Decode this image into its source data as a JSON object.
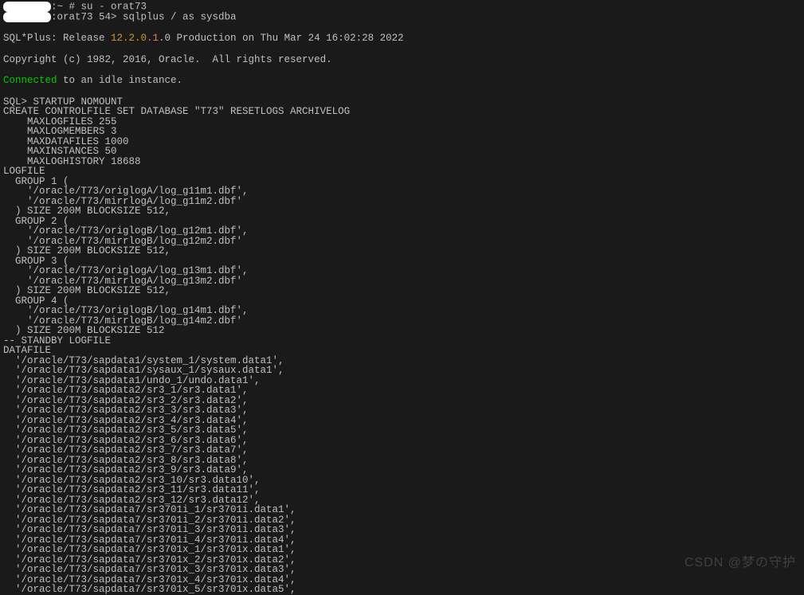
{
  "prompt1_prefix_masked": "        ",
  "prompt1_suffix": ":~ # su - orat73",
  "prompt2_prefix_masked": "        ",
  "prompt2_suffix": ":orat73 54> sqlplus / as sysdba",
  "release_prefix": "SQL*Plus: Release ",
  "release_version": "12.2.0.1",
  "release_suffix": ".0 Production on Thu Mar 24 16:02:28 2022",
  "copyright": "Copyright (c) 1982, 2016, Oracle.  All rights reserved.",
  "connected_word": "Connected",
  "connected_suffix": " to an idle instance.",
  "sql_lines": [
    "SQL> STARTUP NOMOUNT",
    "CREATE CONTROLFILE SET DATABASE \"T73\" RESETLOGS ARCHIVELOG",
    "    MAXLOGFILES 255",
    "    MAXLOGMEMBERS 3",
    "    MAXDATAFILES 1000",
    "    MAXINSTANCES 50",
    "    MAXLOGHISTORY 18688",
    "LOGFILE",
    "  GROUP 1 (",
    "    '/oracle/T73/origlogA/log_g11m1.dbf',",
    "    '/oracle/T73/mirrlogA/log_g11m2.dbf'",
    "  ) SIZE 200M BLOCKSIZE 512,",
    "  GROUP 2 (",
    "    '/oracle/T73/origlogB/log_g12m1.dbf',",
    "    '/oracle/T73/mirrlogB/log_g12m2.dbf'",
    "  ) SIZE 200M BLOCKSIZE 512,",
    "  GROUP 3 (",
    "    '/oracle/T73/origlogA/log_g13m1.dbf',",
    "    '/oracle/T73/mirrlogA/log_g13m2.dbf'",
    "  ) SIZE 200M BLOCKSIZE 512,",
    "  GROUP 4 (",
    "    '/oracle/T73/origlogB/log_g14m1.dbf',",
    "    '/oracle/T73/mirrlogB/log_g14m2.dbf'",
    "  ) SIZE 200M BLOCKSIZE 512",
    "-- STANDBY LOGFILE",
    "DATAFILE",
    "  '/oracle/T73/sapdata1/system_1/system.data1',",
    "  '/oracle/T73/sapdata1/sysaux_1/sysaux.data1',",
    "  '/oracle/T73/sapdata1/undo_1/undo.data1',",
    "  '/oracle/T73/sapdata2/sr3_1/sr3.data1',",
    "  '/oracle/T73/sapdata2/sr3_2/sr3.data2',",
    "  '/oracle/T73/sapdata2/sr3_3/sr3.data3',",
    "  '/oracle/T73/sapdata2/sr3_4/sr3.data4',",
    "  '/oracle/T73/sapdata2/sr3_5/sr3.data5',",
    "  '/oracle/T73/sapdata2/sr3_6/sr3.data6',",
    "  '/oracle/T73/sapdata2/sr3_7/sr3.data7',",
    "  '/oracle/T73/sapdata2/sr3_8/sr3.data8',",
    "  '/oracle/T73/sapdata2/sr3_9/sr3.data9',",
    "  '/oracle/T73/sapdata2/sr3_10/sr3.data10',",
    "  '/oracle/T73/sapdata2/sr3_11/sr3.data11',",
    "  '/oracle/T73/sapdata2/sr3_12/sr3.data12',",
    "  '/oracle/T73/sapdata7/sr3701i_1/sr3701i.data1',",
    "  '/oracle/T73/sapdata7/sr3701i_2/sr3701i.data2',",
    "  '/oracle/T73/sapdata7/sr3701i_3/sr3701i.data3',",
    "  '/oracle/T73/sapdata7/sr3701i_4/sr3701i.data4',",
    "  '/oracle/T73/sapdata7/sr3701x_1/sr3701x.data1',",
    "  '/oracle/T73/sapdata7/sr3701x_2/sr3701x.data2',",
    "  '/oracle/T73/sapdata7/sr3701x_3/sr3701x.data3',",
    "  '/oracle/T73/sapdata7/sr3701x_4/sr3701x.data4',",
    "  '/oracle/T73/sapdata7/sr3701x_5/sr3701x.data5',"
  ],
  "watermark": "CSDN @梦の守护"
}
